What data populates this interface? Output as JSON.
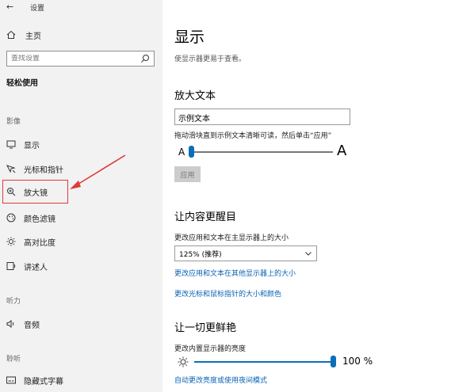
{
  "window": {
    "title": "设置"
  },
  "sidebar": {
    "back_glyph": "←",
    "home_label": "主页",
    "search_placeholder": "查找设置",
    "section_title": "轻松使用",
    "groups": [
      {
        "label": "影像"
      },
      {
        "label": "听力"
      },
      {
        "label": "聆听"
      }
    ],
    "items": [
      {
        "label": "显示",
        "icon": "monitor-icon"
      },
      {
        "label": "光标和指针",
        "icon": "cursor-icon"
      },
      {
        "label": "放大镜",
        "icon": "magnifier-icon"
      },
      {
        "label": "颜色滤镜",
        "icon": "palette-icon"
      },
      {
        "label": "高对比度",
        "icon": "contrast-icon"
      },
      {
        "label": "讲述人",
        "icon": "narrator-icon"
      },
      {
        "label": "音频",
        "icon": "speaker-icon"
      },
      {
        "label": "隐藏式字幕",
        "icon": "caption-icon"
      }
    ]
  },
  "annotation": {
    "highlight_color": "#e03a3a"
  },
  "main": {
    "title": "显示",
    "subtitle": "使显示器更易于查看。",
    "enlarge_text": {
      "heading": "放大文本",
      "sample_text": "示例文本",
      "instruction": "拖动滑块直到示例文本清晰可读，然后单击“应用”",
      "small_a": "A",
      "large_a": "A",
      "slider_value": 0.0,
      "apply_label": "应用"
    },
    "make_prominent": {
      "heading": "让内容更醒目",
      "scale_label": "更改应用和文本在主显示器上的大小",
      "scale_value": "125% (推荐)",
      "link_other_displays": "更改应用和文本在其他显示器上的大小",
      "link_cursor": "更改光标和鼠标指针的大小和颜色"
    },
    "brighter": {
      "heading": "让一切更鲜艳",
      "brightness_label": "更改内置显示器的亮度",
      "brightness_value": "100 %",
      "brightness_level": 1.0,
      "link_auto": "自动更改亮度或使用夜间模式"
    }
  },
  "colors": {
    "accent": "#0b6fb8",
    "link": "#0a63b5",
    "sidebar_bg": "#f2f2f2"
  }
}
